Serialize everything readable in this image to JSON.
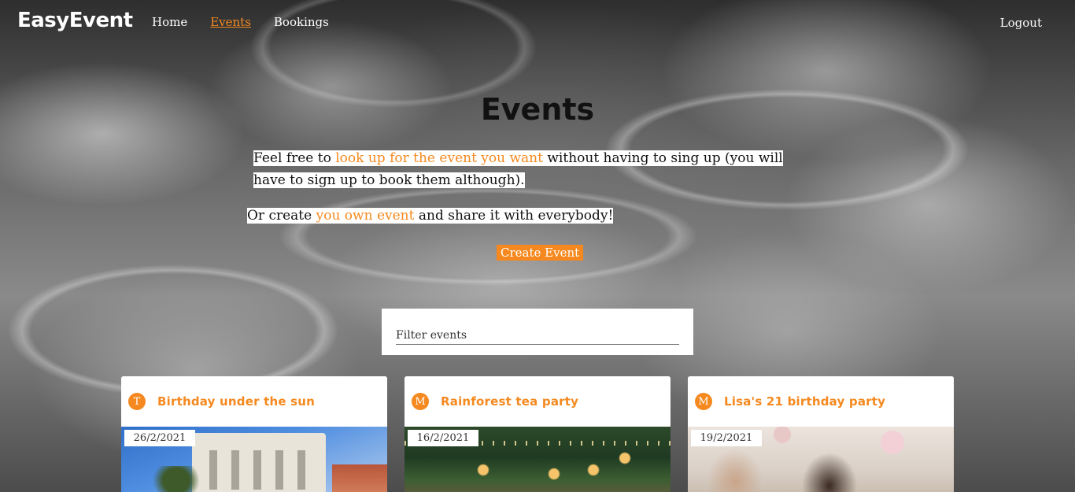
{
  "nav": {
    "brand": "EasyEvent",
    "links": [
      "Home",
      "Events",
      "Bookings"
    ],
    "active": "Events",
    "logout": "Logout"
  },
  "hero": {
    "title": "Events",
    "para1_before": "Feel free to ",
    "para1_link": "look up for the event you want",
    "para1_after": " without having to sing up (you will have to sign up to book them although).",
    "para2_before": "Or create ",
    "para2_link": "you own event",
    "para2_after": " and share it with everybody!",
    "create_button": "Create Event"
  },
  "filter": {
    "placeholder": "Filter events"
  },
  "events": [
    {
      "avatar": "T",
      "title": "Birthday under the sun",
      "date": "26/2/2021"
    },
    {
      "avatar": "M",
      "title": "Rainforest tea party",
      "date": "16/2/2021"
    },
    {
      "avatar": "M",
      "title": "Lisa's 21 birthday party",
      "date": "19/2/2021"
    }
  ],
  "colors": {
    "accent": "#f5891f"
  }
}
